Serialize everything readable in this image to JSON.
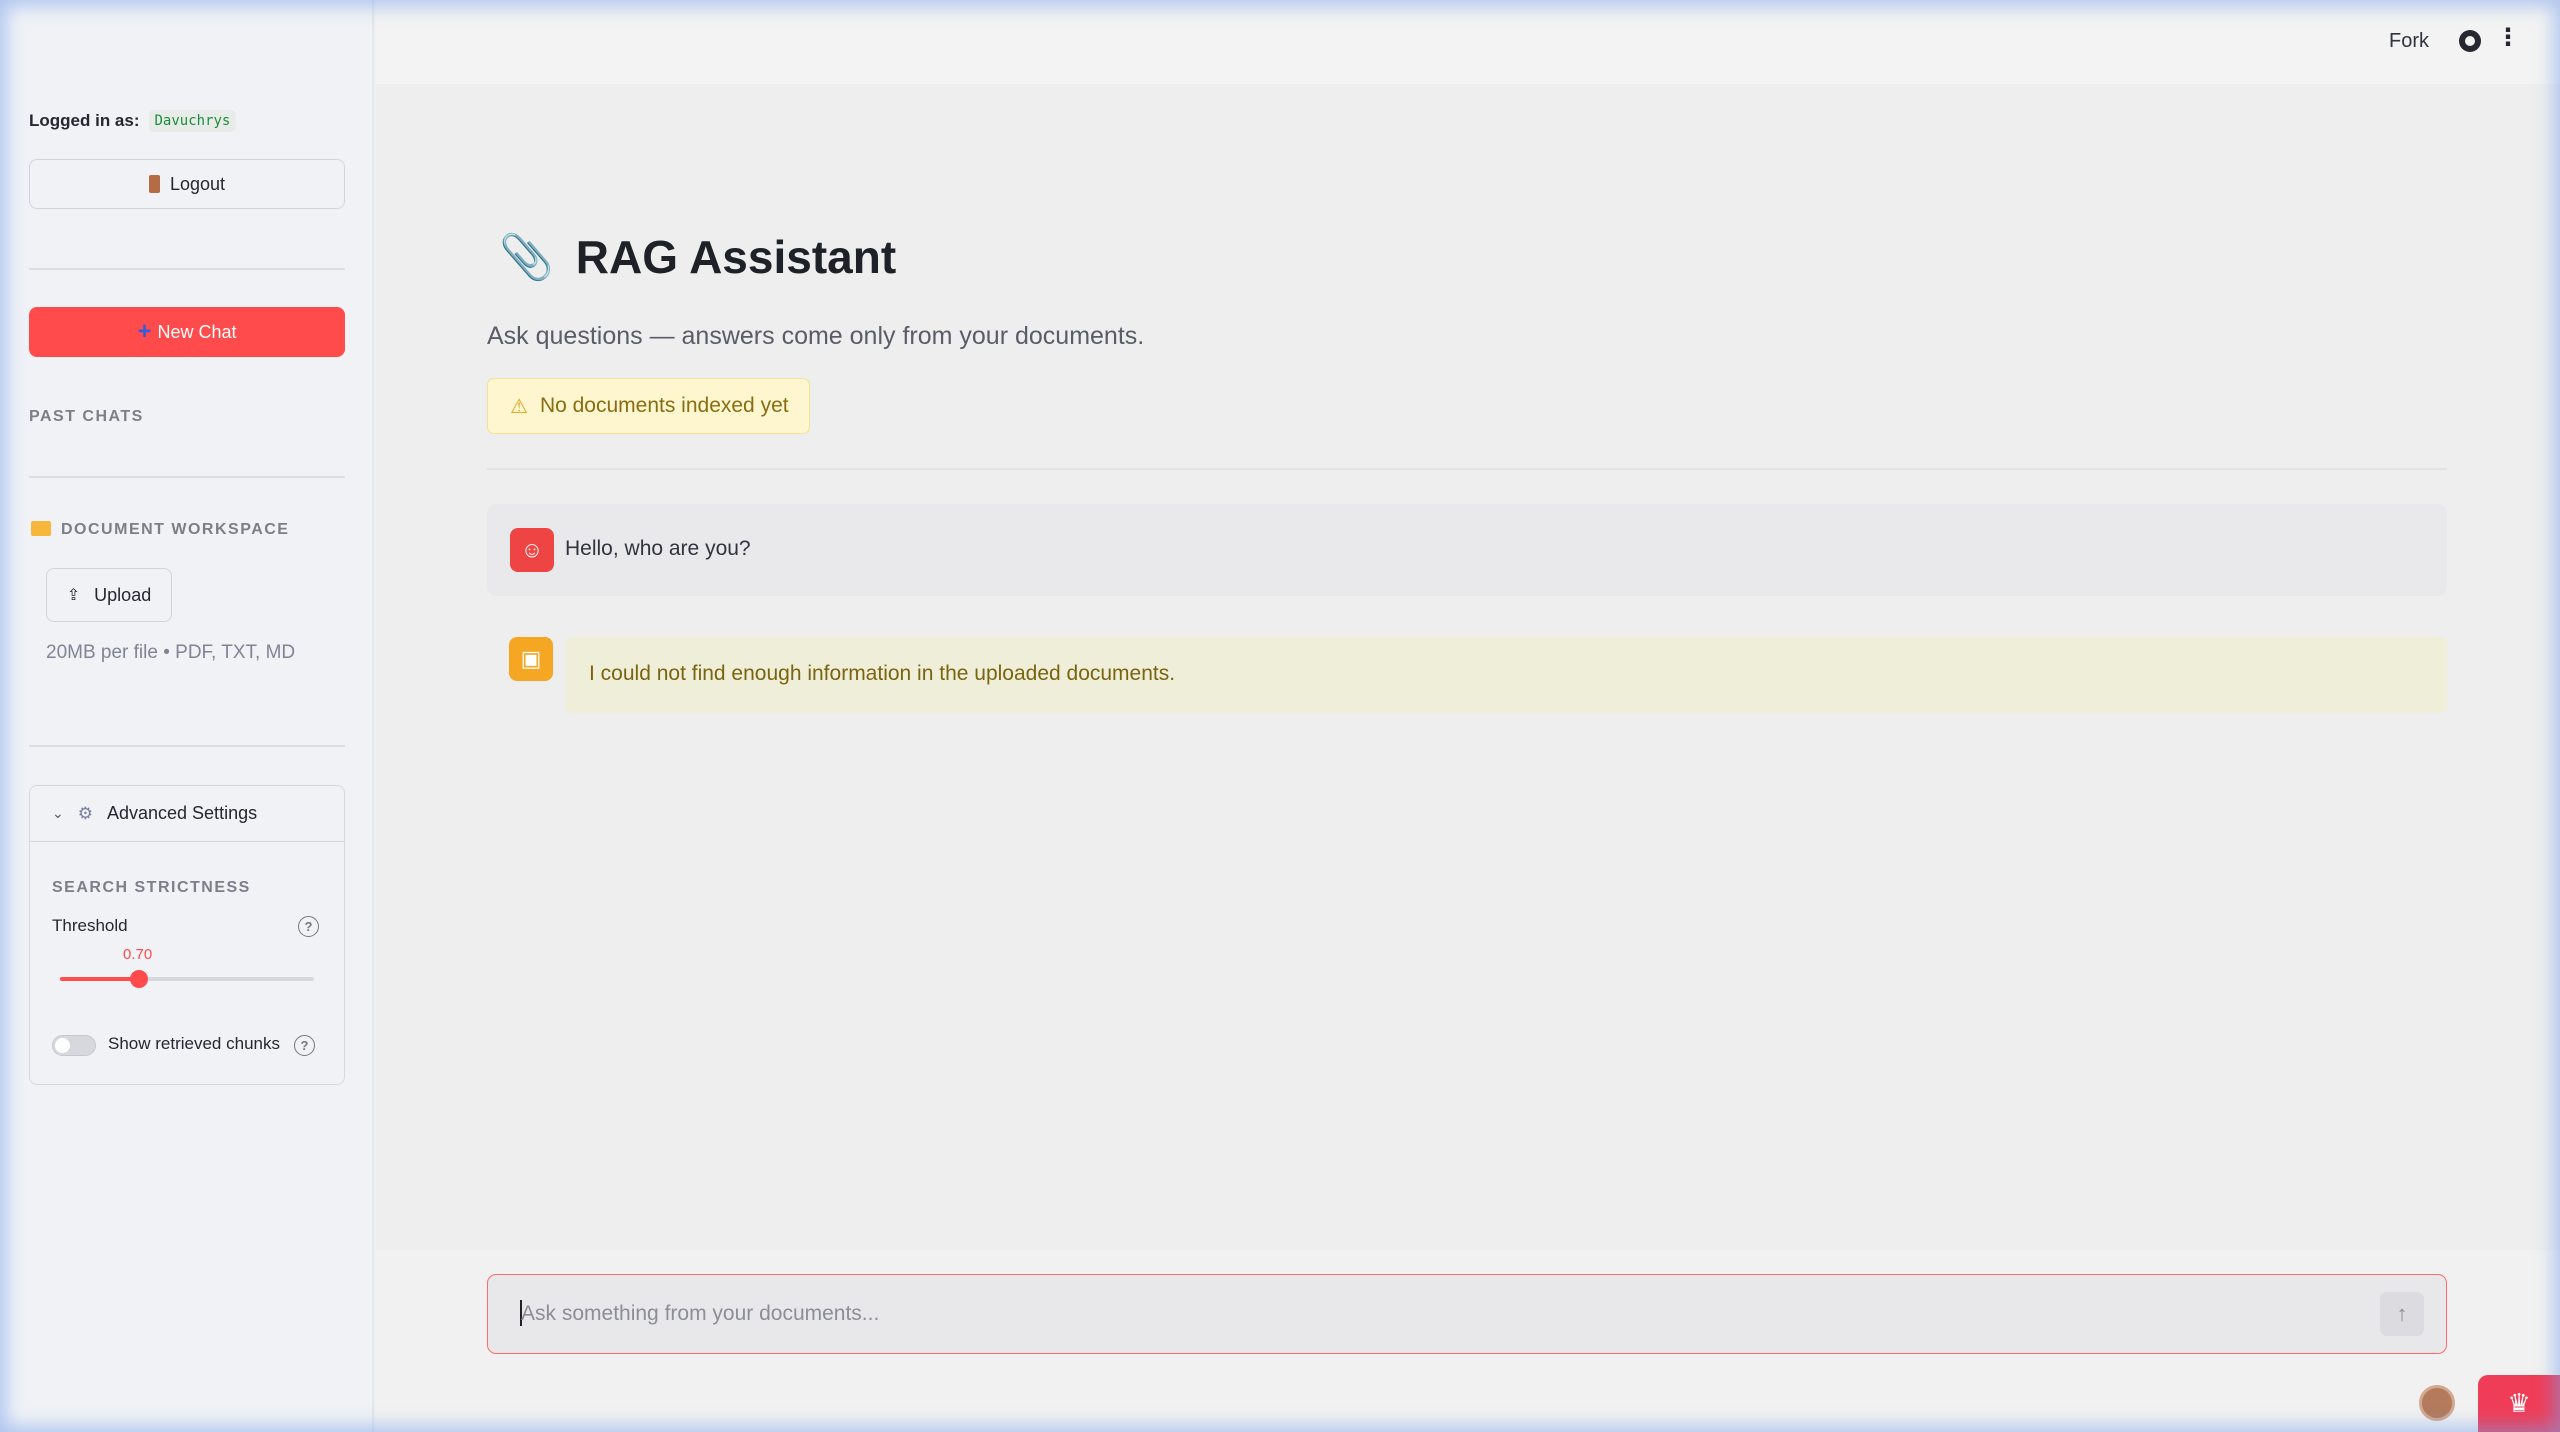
{
  "sidebar": {
    "logged_in_label": "Logged in as:",
    "username": "Davuchrys",
    "logout_label": "Logout",
    "new_chat_label": "New Chat",
    "past_chats_label": "PAST CHATS",
    "workspace_label": "DOCUMENT WORKSPACE",
    "upload_label": "Upload",
    "upload_hint": "20MB per file • PDF, TXT, MD",
    "advanced": {
      "title": "Advanced Settings",
      "section_label": "SEARCH STRICTNESS",
      "threshold_label": "Threshold",
      "threshold_value": "0.70",
      "threshold_fraction": 0.31,
      "show_chunks_label": "Show retrieved chunks",
      "show_chunks_on": false
    }
  },
  "header": {
    "fork_label": "Fork",
    "github_icon": "github-icon",
    "menu_icon": "kebab-menu-icon"
  },
  "main": {
    "title": "RAG Assistant",
    "title_icon": "paperclip-icon",
    "subtitle": "Ask questions — answers come only from your documents.",
    "warning": "No documents indexed yet",
    "messages": [
      {
        "role": "user",
        "text": "Hello, who are you?"
      },
      {
        "role": "assistant",
        "text": "I could not find enough information in the uploaded documents."
      }
    ]
  },
  "chat_input": {
    "placeholder": "Ask something from your documents..."
  },
  "colors": {
    "primary": "#ff4b4b",
    "sidebar_bg": "#f0f2f6",
    "warning_bg": "#fdf6cf",
    "assistant_avatar": "#f5a623",
    "user_avatar": "#ef4444"
  }
}
